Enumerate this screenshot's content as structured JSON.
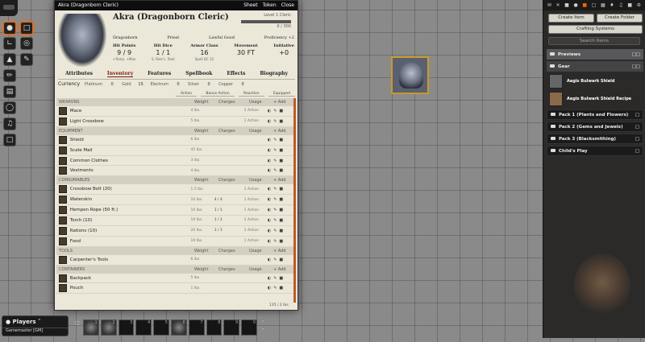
{
  "window": {
    "title": "Akra (Dragonborn Cleric)",
    "sheet_btn": "Sheet",
    "token_btn": "Token",
    "close_btn": "Close"
  },
  "character": {
    "name": "Akra (Dragonborn Cleric)",
    "level": "Level 1 Cleric",
    "xp": "0 / 300",
    "race": "Dragonborn",
    "background": "Priest",
    "alignment": "Lawful Good",
    "proficiency": "Proficiency +2"
  },
  "stats": [
    {
      "label": "Hit Points",
      "value": "9 / 9",
      "sub": "+Temp. +Max"
    },
    {
      "label": "Hit Dice",
      "value": "1 / 1",
      "sub": "S. Rest L. Rest"
    },
    {
      "label": "Armor Class",
      "value": "16",
      "sub": "Spell DC 12"
    },
    {
      "label": "Movement",
      "value": "30 FT",
      "sub": ""
    },
    {
      "label": "Initiative",
      "value": "+0",
      "sub": ""
    }
  ],
  "tabs": [
    "Attributes",
    "Inventory",
    "Features",
    "Spellbook",
    "Effects",
    "Biography"
  ],
  "currency": {
    "label": "Currency",
    "coins": [
      {
        "name": "Platinum",
        "value": "0"
      },
      {
        "name": "Gold",
        "value": "15"
      },
      {
        "name": "Electrum",
        "value": "0"
      },
      {
        "name": "Silver",
        "value": "0"
      },
      {
        "name": "Copper",
        "value": "0"
      }
    ]
  },
  "action_headers": [
    "Action",
    "Bonus Action",
    "Reaction",
    "Equipped"
  ],
  "columns": {
    "weight": "Weight",
    "charges": "Charges",
    "usage": "Usage",
    "add": "+ Add"
  },
  "sections": [
    {
      "name": "Weapons",
      "items": [
        {
          "name": "Mace",
          "weight": "4 lbs.",
          "charges": "",
          "usage": "1 Action"
        },
        {
          "name": "Light Crossbow",
          "weight": "5 lbs.",
          "charges": "",
          "usage": "1 Action"
        }
      ]
    },
    {
      "name": "Equipment",
      "items": [
        {
          "name": "Shield",
          "weight": "6 lbs.",
          "charges": "",
          "usage": ""
        },
        {
          "name": "Scale Mail",
          "weight": "45 lbs.",
          "charges": "",
          "usage": ""
        },
        {
          "name": "Common Clothes",
          "weight": "3 lbs.",
          "charges": "",
          "usage": ""
        },
        {
          "name": "Vestments",
          "weight": "4 lbs.",
          "charges": "",
          "usage": ""
        }
      ]
    },
    {
      "name": "Consumables",
      "items": [
        {
          "name": "Crossbow Bolt (20)",
          "weight": "1.5 lbs.",
          "charges": "",
          "usage": "1 Action"
        },
        {
          "name": "Waterskin",
          "weight": "10 lbs.",
          "charges": "4 / 4",
          "usage": "1 Action"
        },
        {
          "name": "Hempen Rope (50 ft.)",
          "weight": "10 lbs.",
          "charges": "1 / 1",
          "usage": "1 Action"
        },
        {
          "name": "Torch (10)",
          "weight": "10 lbs.",
          "charges": "1 / 1",
          "usage": "1 Action"
        },
        {
          "name": "Rations (10)",
          "weight": "20 lbs.",
          "charges": "1 / 1",
          "usage": "1 Action"
        },
        {
          "name": "Food",
          "weight": "10 lbs.",
          "charges": "",
          "usage": "1 Action"
        }
      ]
    },
    {
      "name": "Tools",
      "items": [
        {
          "name": "Carpenter's Tools",
          "weight": "6 lbs.",
          "charges": "",
          "usage": ""
        }
      ]
    },
    {
      "name": "Containers",
      "items": [
        {
          "name": "Backpack",
          "weight": "5 lbs.",
          "charges": "",
          "usage": ""
        },
        {
          "name": "Pouch",
          "weight": "1 lbs.",
          "charges": "",
          "usage": ""
        }
      ]
    }
  ],
  "sheet_footer": "135 / 2 lbs.",
  "sidebar": {
    "create_item": "Create Item",
    "create_folder": "Create Folder",
    "crafting": "Crafting Systems",
    "search_placeholder": "Search Items",
    "folders": {
      "previews": "Previews",
      "gear": "Gear",
      "pack1": "Pack 1 (Plants and Flowers)",
      "pack2": "Pack 2 (Gems and Jewels)",
      "pack3": "Pack 3 (Blacksmithing)",
      "childs": "Child's Play"
    },
    "entries": [
      "Aegis Bulwark Shield",
      "Aegis Bulwark Shield Recipe"
    ]
  },
  "players": {
    "title": "Players",
    "gm": "Gamemaster [GM]"
  },
  "hotbar": {
    "slots": [
      "1",
      "2",
      "3",
      "4",
      "5",
      "6",
      "7",
      "8",
      "9",
      "0"
    ]
  },
  "colors": {
    "accent": "#ff6400",
    "sheet_bg": "#ebe7d9",
    "active_tab": "#7a1d12"
  }
}
